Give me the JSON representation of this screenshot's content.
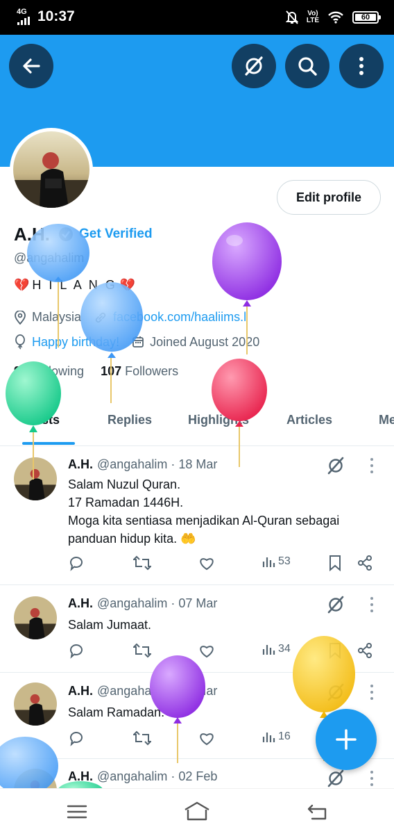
{
  "status_bar": {
    "network": "4G",
    "time": "10:37",
    "volte": "Vo)\nLTE",
    "battery": "60"
  },
  "header": {
    "back_icon": "arrow-left-icon",
    "grok_icon": "grok-icon",
    "search_icon": "search-icon",
    "more_icon": "more-vertical-icon",
    "banner_color": "#1d9bf0"
  },
  "profile": {
    "edit_label": "Edit profile",
    "name": "A.H.",
    "get_verified": "Get Verified",
    "handle": "@angahalim",
    "bio_text": "H I L A N G",
    "location": "Malaysia",
    "website": "facebook.com/haaliims.l",
    "birthday": "Happy birthday!",
    "joined": "Joined August 2020",
    "following_count": "99",
    "following_label": "Following",
    "followers_count": "107",
    "followers_label": "Followers"
  },
  "tabs": [
    {
      "label": "Posts",
      "active": true
    },
    {
      "label": "Replies",
      "active": false
    },
    {
      "label": "Highlights",
      "active": false
    },
    {
      "label": "Articles",
      "active": false
    },
    {
      "label": "Me",
      "active": false
    }
  ],
  "posts": [
    {
      "name": "A.H.",
      "meta": "@angahalim · 18 Mar",
      "lines": [
        "Salam Nuzul Quran.",
        "17 Ramadan 1446H.",
        "Moga kita sentiasa menjadikan Al-Quran sebagai",
        "panduan hidup kita. 🤲"
      ],
      "views": "53"
    },
    {
      "name": "A.H.",
      "meta": "@angahalim · 07 Mar",
      "lines": [
        "Salam Jumaat."
      ],
      "views": "34"
    },
    {
      "name": "A.H.",
      "meta": "@angahalim · 02 Mar",
      "lines": [
        "Salam Ramadan."
      ],
      "views": "16"
    },
    {
      "name": "A.H.",
      "meta": "@angahalim · 02 Feb",
      "lines": [],
      "views": ""
    }
  ],
  "colors": {
    "accent": "#1d9bf0",
    "text": "#0f1419",
    "muted": "#536471"
  },
  "fab_icon": "plus-icon",
  "nav": [
    "menu-icon",
    "home-icon",
    "back-icon"
  ]
}
